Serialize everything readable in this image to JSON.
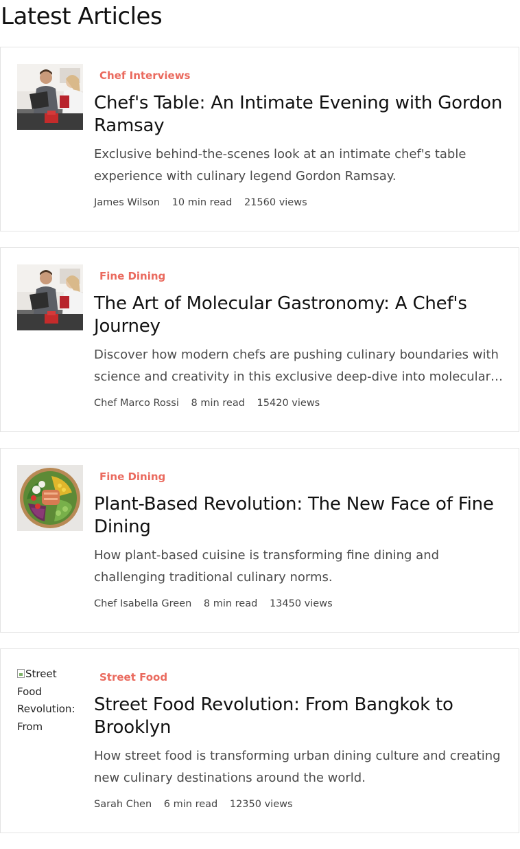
{
  "header": {
    "title": "Latest Articles"
  },
  "articles": [
    {
      "category": "Chef Interviews",
      "title": "Chef's Table: An Intimate Evening with Gordon Ramsay",
      "excerpt": "Exclusive behind-the-scenes look at an intimate chef's table experience with culinary legend Gordon Ramsay.",
      "author": "James Wilson",
      "read_time": "10 min read",
      "views": "21560 views",
      "image": "chefs-cooking-photo"
    },
    {
      "category": "Fine Dining",
      "title": "The Art of Molecular Gastronomy: A Chef's Journey",
      "excerpt": "Discover how modern chefs are pushing culinary boundaries with science and creativity in this exclusive deep-dive into molecular gastronomy.",
      "author": "Chef Marco Rossi",
      "read_time": "8 min read",
      "views": "15420 views",
      "image": "chefs-cooking-photo"
    },
    {
      "category": "Fine Dining",
      "title": "Plant-Based Revolution: The New Face of Fine Dining",
      "excerpt": "How plant-based cuisine is transforming fine dining and challenging traditional culinary norms.",
      "author": "Chef Isabella Green",
      "read_time": "8 min read",
      "views": "13450 views",
      "image": "salad-bowl-photo"
    },
    {
      "category": "Street Food",
      "title": "Street Food Revolution: From Bangkok to Brooklyn",
      "excerpt": "How street food is transforming urban dining culture and creating new culinary destinations around the world.",
      "author": "Sarah Chen",
      "read_time": "6 min read",
      "views": "12350 views",
      "image": "broken-image",
      "image_alt": "Street Food Revolution: From"
    }
  ]
}
